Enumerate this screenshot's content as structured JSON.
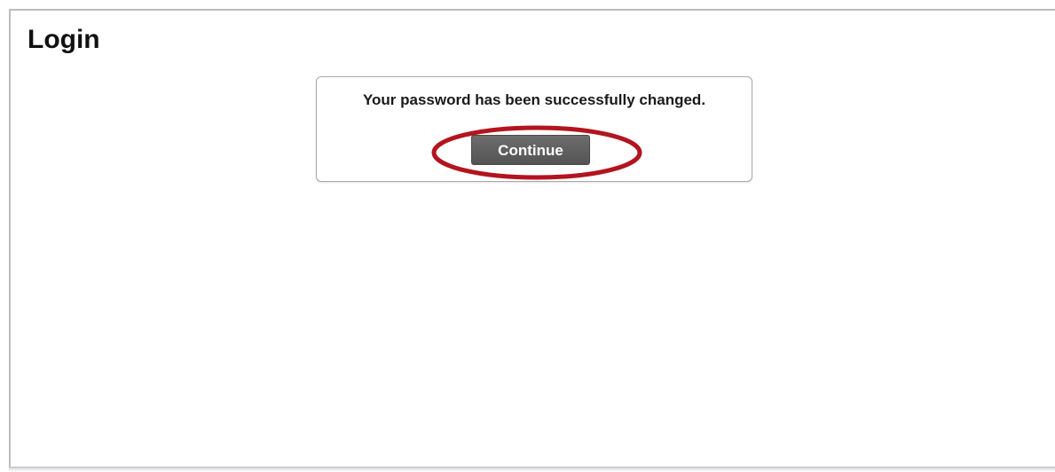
{
  "page": {
    "title": "Login"
  },
  "dialog": {
    "message": "Your password has been successfully changed.",
    "continue_label": "Continue"
  },
  "annotation": {
    "highlight_color": "#b3141f"
  }
}
